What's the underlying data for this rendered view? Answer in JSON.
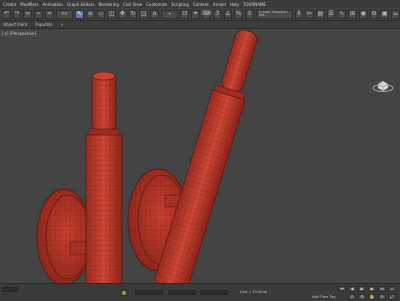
{
  "menu": {
    "items": [
      "Create",
      "Modifiers",
      "Animation",
      "Graph Editors",
      "Rendering",
      "Civil View",
      "Customize",
      "Scripting",
      "Content",
      "Arnold",
      "Help",
      "TOURNAME"
    ]
  },
  "toolbar": {
    "selection_filter": "All",
    "named_selection": "Create Selection Set"
  },
  "ribbon": {
    "tabs": [
      "Object Paint",
      "Populate"
    ]
  },
  "viewport": {
    "label": "[+] [Perspective]"
  },
  "status": {
    "coord_readout": "Grid = 10.0mm",
    "time_tag": "Add Time Tag"
  },
  "colors": {
    "mesh": "#c0392b",
    "mesh_dark": "#7a1f17",
    "viewport_bg": "#444444"
  }
}
